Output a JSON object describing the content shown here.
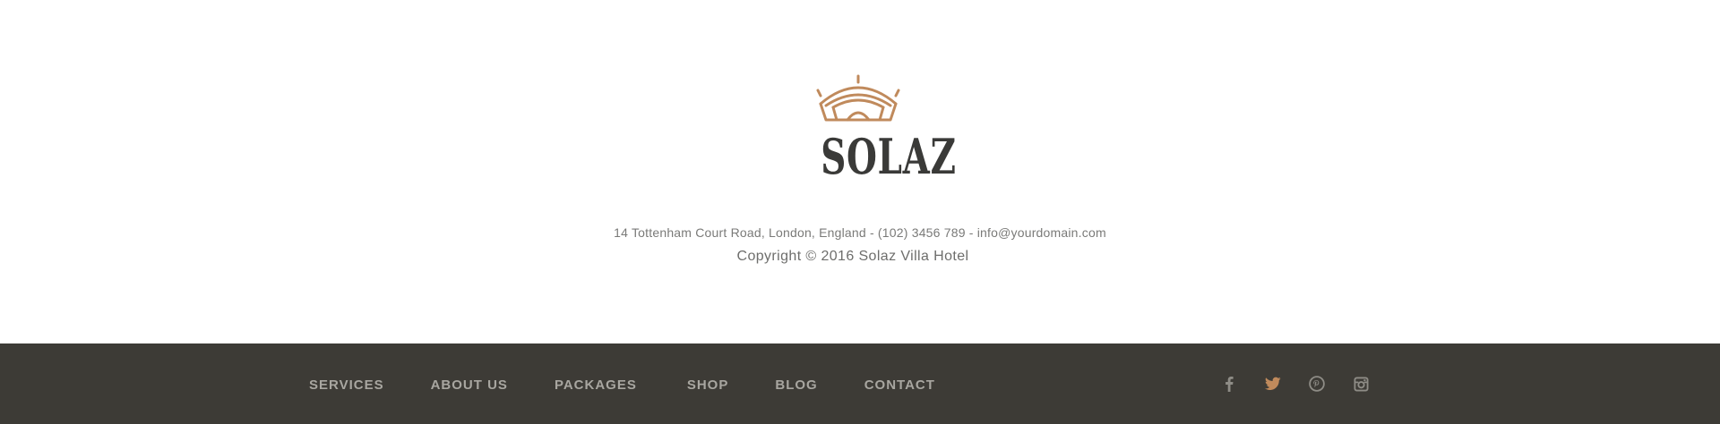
{
  "brand": {
    "name": "SOLAZ",
    "accent_color": "#c08a5c",
    "text_color": "#3a3a38"
  },
  "footer": {
    "address": "14 Tottenham Court Road, London, England - (102) 3456 789 - info@yourdomain.com",
    "copyright": "Copyright © 2016 Solaz Villa Hotel",
    "bar_color": "#3d3b36"
  },
  "nav": {
    "items": [
      {
        "label": "SERVICES"
      },
      {
        "label": "ABOUT US"
      },
      {
        "label": "PACKAGES"
      },
      {
        "label": "SHOP"
      },
      {
        "label": "BLOG"
      },
      {
        "label": "CONTACT"
      }
    ]
  },
  "social": {
    "icons": [
      {
        "name": "facebook-icon",
        "color": "#8e8c86"
      },
      {
        "name": "twitter-icon",
        "color": "#c08a5c"
      },
      {
        "name": "pinterest-icon",
        "color": "#8e8c86"
      },
      {
        "name": "instagram-icon",
        "color": "#8e8c86"
      }
    ]
  }
}
